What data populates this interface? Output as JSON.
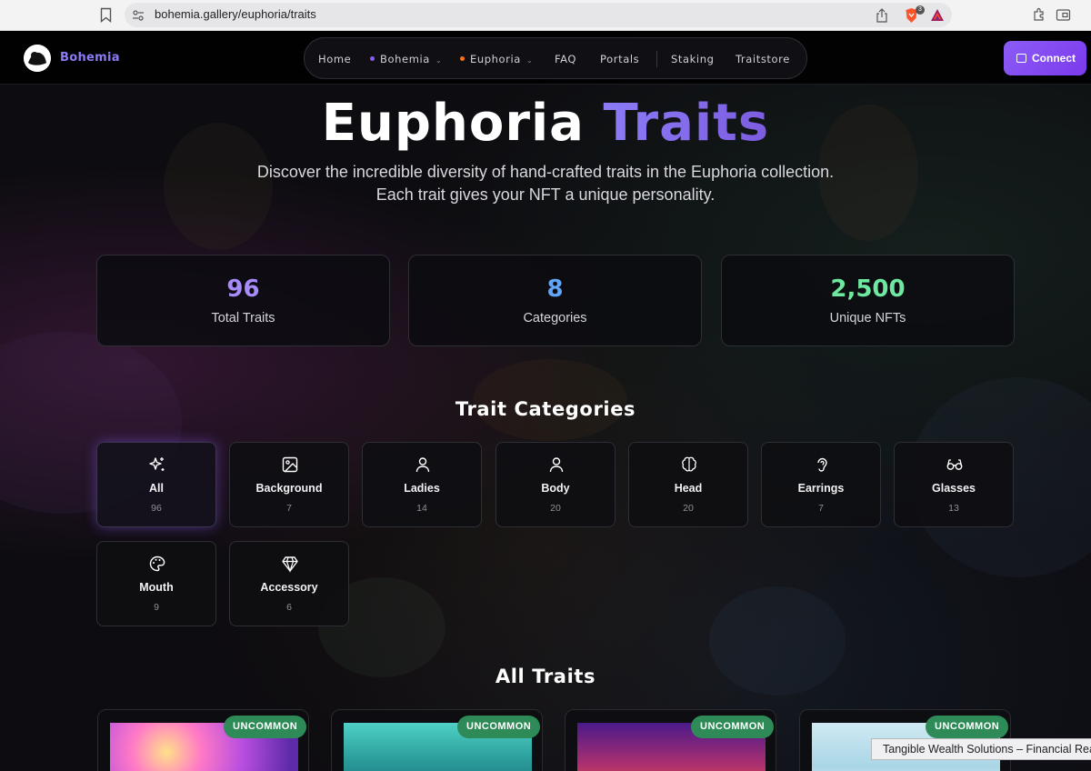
{
  "browser": {
    "url": "bohemia.gallery/euphoria/traits",
    "brave_badge_count": "3"
  },
  "nav": {
    "brand": "Bohemia",
    "items": [
      {
        "label": "Home"
      },
      {
        "label": "Bohemia",
        "dot_color": "#8b5cf6",
        "dropdown": true
      },
      {
        "label": "Euphoria",
        "dot_color": "#f97316",
        "dropdown": true
      },
      {
        "label": "FAQ"
      },
      {
        "label": "Portals"
      },
      {
        "label": "Staking"
      },
      {
        "label": "Traitstore"
      }
    ],
    "connect_label": "Connect"
  },
  "hero": {
    "title_main": "Euphoria",
    "title_accent": "Traits",
    "subtitle_line1": "Discover the incredible diversity of hand-crafted traits in the Euphoria collection.",
    "subtitle_line2": "Each trait gives your NFT a unique personality."
  },
  "stats": [
    {
      "value": "96",
      "label": "Total Traits",
      "color": "#a78bfa"
    },
    {
      "value": "8",
      "label": "Categories",
      "color": "#60a5fa"
    },
    {
      "value": "2,500",
      "label": "Unique NFTs",
      "color": "#6ee7a0"
    }
  ],
  "categories_title": "Trait Categories",
  "categories": [
    {
      "name": "All",
      "count": "96",
      "icon": "sparkles-icon",
      "active": true
    },
    {
      "name": "Background",
      "count": "7",
      "icon": "image-icon"
    },
    {
      "name": "Ladies",
      "count": "14",
      "icon": "user-icon"
    },
    {
      "name": "Body",
      "count": "20",
      "icon": "user-icon"
    },
    {
      "name": "Head",
      "count": "20",
      "icon": "brain-icon"
    },
    {
      "name": "Earrings",
      "count": "7",
      "icon": "ear-icon"
    },
    {
      "name": "Glasses",
      "count": "13",
      "icon": "glasses-icon"
    },
    {
      "name": "Mouth",
      "count": "9",
      "icon": "palette-icon"
    },
    {
      "name": "Accessory",
      "count": "6",
      "icon": "gem-icon"
    }
  ],
  "all_traits_title": "All Traits",
  "trait_cards": [
    {
      "rarity": "UNCOMMON"
    },
    {
      "rarity": "UNCOMMON"
    },
    {
      "rarity": "UNCOMMON"
    },
    {
      "rarity": "UNCOMMON"
    }
  ],
  "tooltip": "Tangible Wealth Solutions – Financial Rea",
  "colors": {
    "accent": "#8b5cf6",
    "rarity_uncommon": "#2e8b57",
    "page_bg": "#0d0c10"
  }
}
